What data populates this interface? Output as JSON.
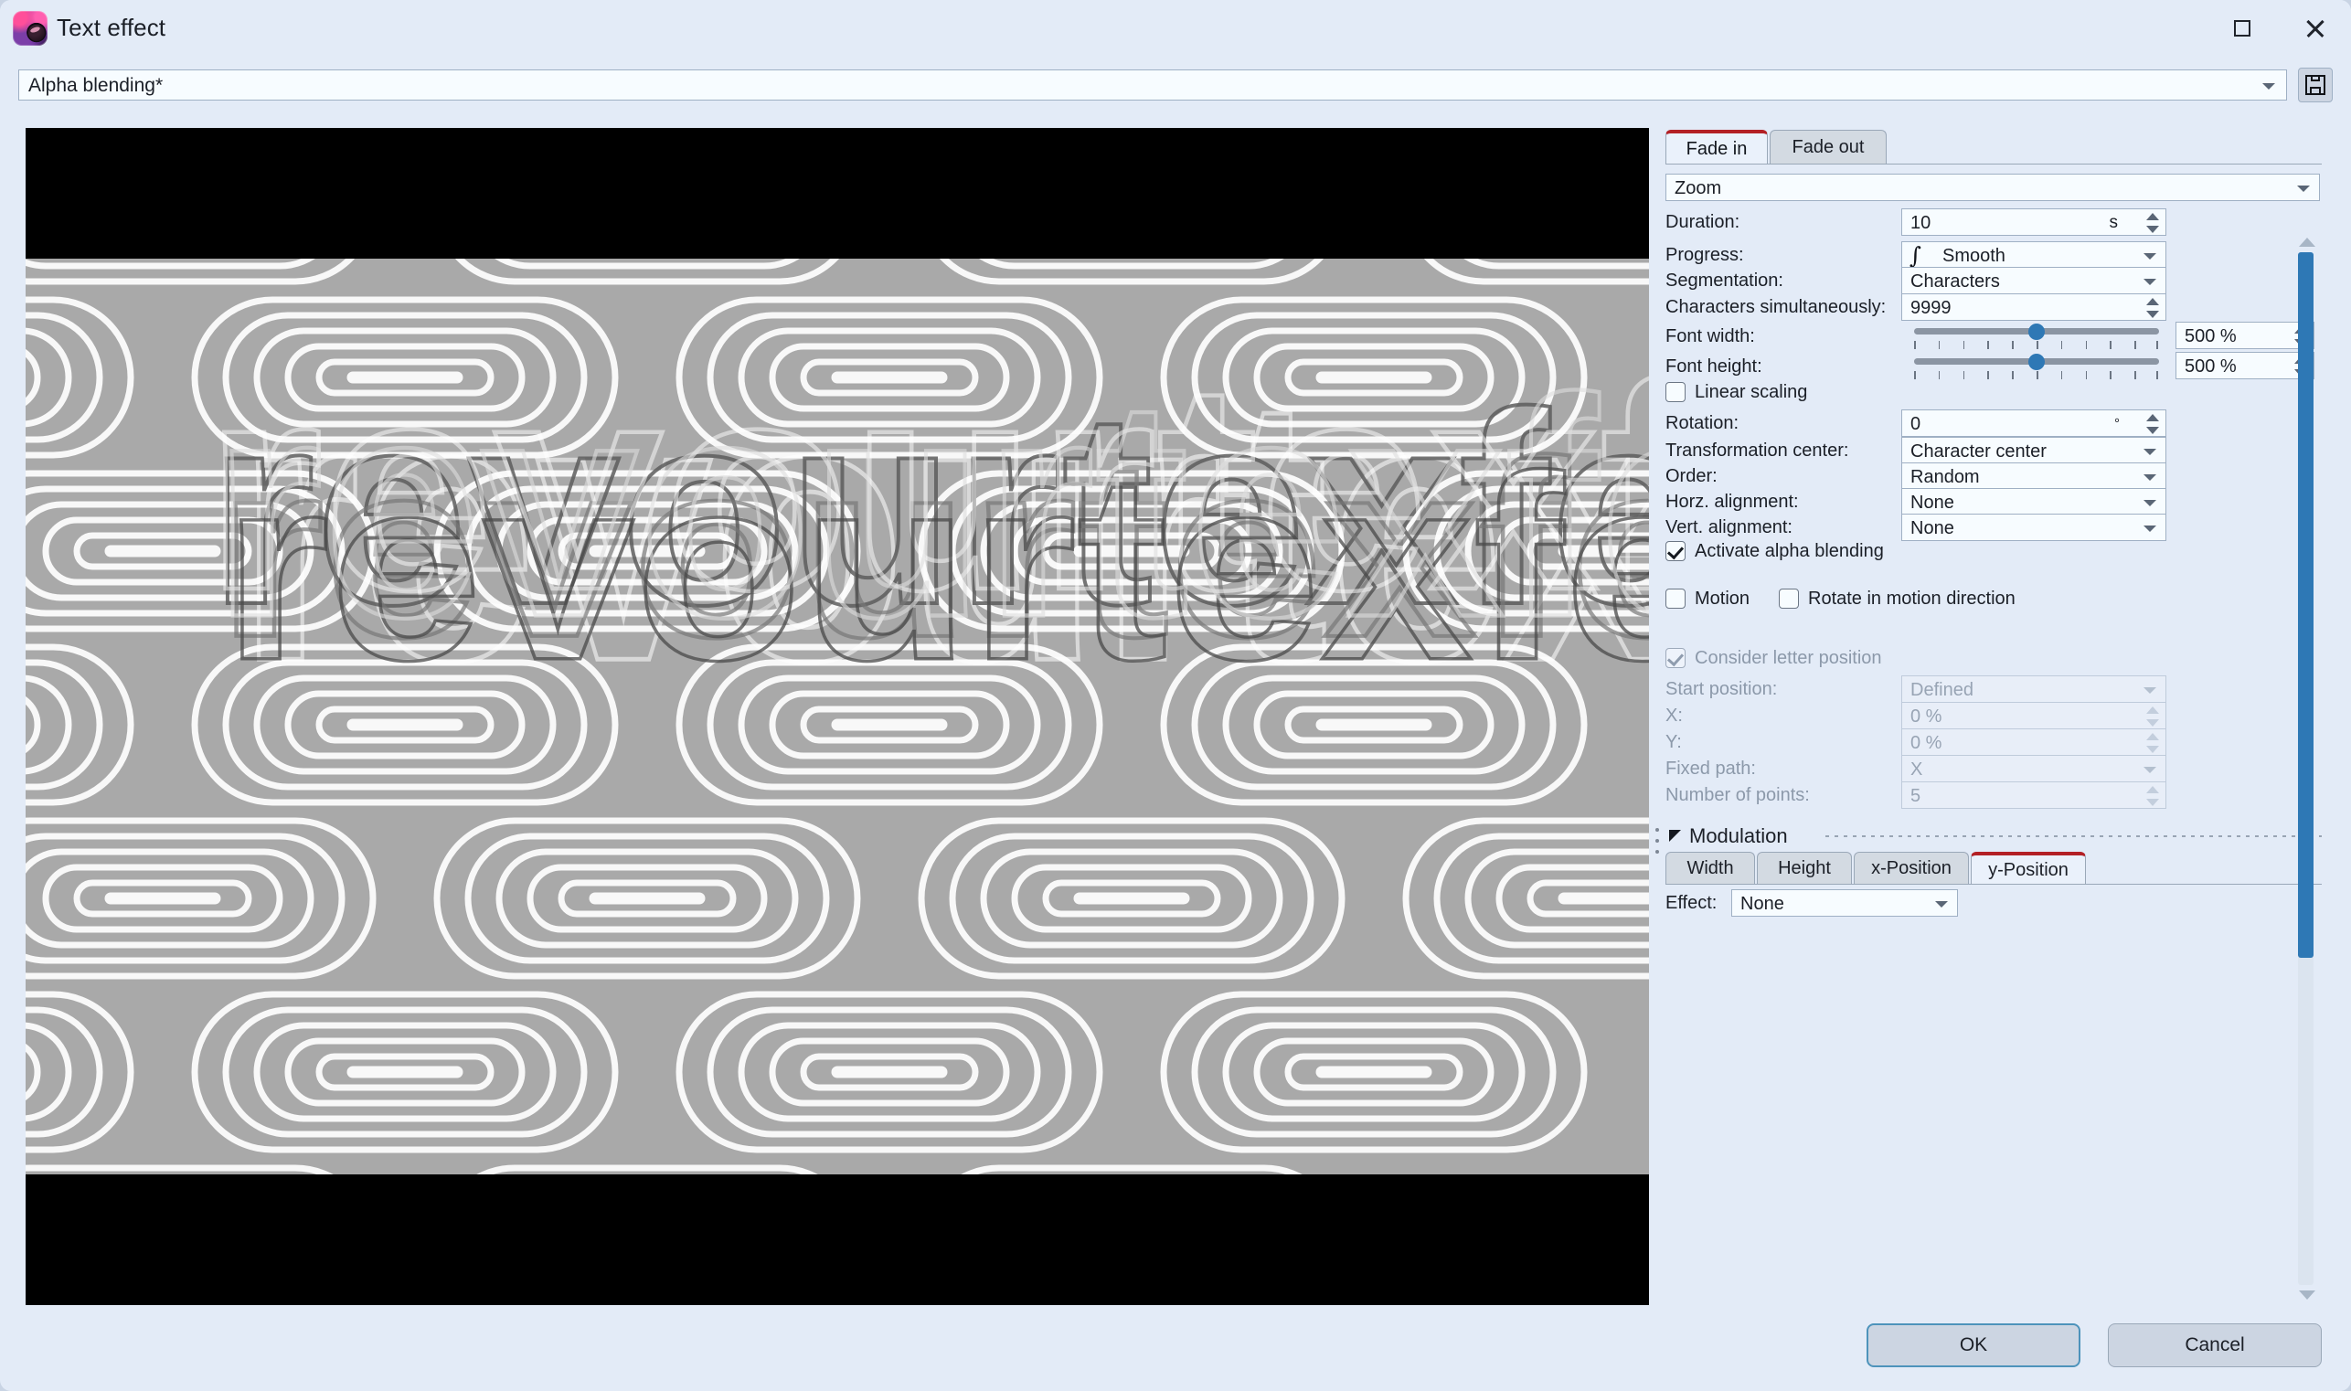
{
  "window": {
    "title": "Text effect",
    "app_icon": "app-icon",
    "maximize_icon": "maximize-icon",
    "close_icon": "close-icon"
  },
  "preset": {
    "value": "Alpha blending*",
    "save_icon": "floppy-disk-icon",
    "dropdown_icon": "chevron-down-icon"
  },
  "preview": {
    "text": "revourtexfee",
    "background_color": "#a9a9a9",
    "letterbox_color": "#000000"
  },
  "tabs": [
    {
      "label": "Fade in",
      "active": true
    },
    {
      "label": "Fade out",
      "active": false
    }
  ],
  "effect": {
    "value": "Zoom"
  },
  "fields": {
    "duration": {
      "label": "Duration:",
      "value": "10",
      "unit": "s"
    },
    "progress": {
      "label": "Progress:",
      "value": "Smooth",
      "icon": "smooth-curve-icon"
    },
    "segmentation": {
      "label": "Segmentation:",
      "value": "Characters"
    },
    "characters_simultaneously": {
      "label": "Characters simultaneously:",
      "value": "9999"
    },
    "font_width": {
      "label": "Font width:",
      "value": "500 %",
      "slider_pct": 50,
      "ticks": 11
    },
    "font_height": {
      "label": "Font height:",
      "value": "500 %",
      "slider_pct": 50,
      "ticks": 11
    },
    "linear_scaling": {
      "label": "Linear scaling",
      "checked": false
    },
    "rotation": {
      "label": "Rotation:",
      "value": "0",
      "unit": "°"
    },
    "transformation_center": {
      "label": "Transformation center:",
      "value": "Character center"
    },
    "order": {
      "label": "Order:",
      "value": "Random"
    },
    "horz_alignment": {
      "label": "Horz. alignment:",
      "value": "None"
    },
    "vert_alignment": {
      "label": "Vert. alignment:",
      "value": "None"
    },
    "activate_alpha_blending": {
      "label": "Activate alpha blending",
      "checked": true
    },
    "motion": {
      "label": "Motion",
      "checked": false
    },
    "rotate_in_motion_direction": {
      "label": "Rotate in motion direction",
      "checked": false
    },
    "consider_letter_position": {
      "label": "Consider letter position",
      "checked": true,
      "disabled": true
    },
    "start_position": {
      "label": "Start position:",
      "value": "Defined",
      "disabled": true
    },
    "x": {
      "label": "X:",
      "value": "0 %",
      "disabled": true
    },
    "y": {
      "label": "Y:",
      "value": "0 %",
      "disabled": true
    },
    "fixed_path": {
      "label": "Fixed path:",
      "value": "X",
      "disabled": true
    },
    "number_of_points": {
      "label": "Number of points:",
      "value": "5",
      "disabled": true
    }
  },
  "modulation": {
    "title": "Modulation",
    "collapse_icon": "collapse-triangle-icon",
    "tabs": [
      {
        "label": "Width",
        "active": false
      },
      {
        "label": "Height",
        "active": false
      },
      {
        "label": "x-Position",
        "active": false
      },
      {
        "label": "y-Position",
        "active": true
      }
    ],
    "effect": {
      "label": "Effect:",
      "value": "None"
    }
  },
  "footer": {
    "ok": "OK",
    "cancel": "Cancel"
  },
  "colors": {
    "accent_red": "#b32025",
    "accent_blue": "#2e78b5",
    "panel_bg": "#e3ebf7"
  }
}
